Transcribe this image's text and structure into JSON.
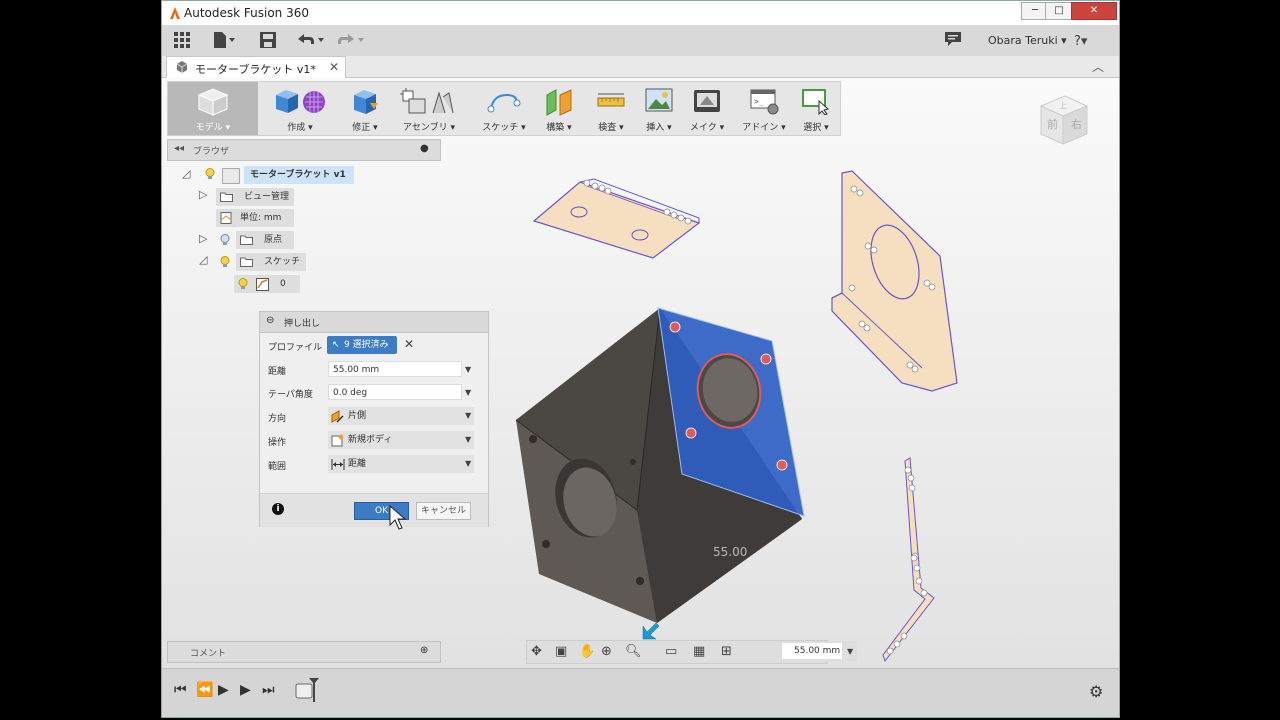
{
  "window": {
    "title": "Autodesk Fusion 360",
    "minimize": "─",
    "maximize": "□",
    "close": "✕"
  },
  "quickbar": {
    "user": "Obara Teruki ▾",
    "help": "?▾"
  },
  "tab": {
    "label": "モーターブラケット v1*",
    "close": "✕"
  },
  "toolbar": [
    {
      "label": "モデル ▾"
    },
    {
      "label": "作成 ▾"
    },
    {
      "label": "修正 ▾"
    },
    {
      "label": "アセンブリ ▾"
    },
    {
      "label": "スケッチ ▾"
    },
    {
      "label": "構築 ▾"
    },
    {
      "label": "検査 ▾"
    },
    {
      "label": "挿入 ▾"
    },
    {
      "label": "メイク ▾"
    },
    {
      "label": "アドイン ▾"
    },
    {
      "label": "選択 ▾"
    }
  ],
  "browser": {
    "title": "ブラウザ",
    "root": "モーターブラケット v1",
    "items": [
      "ビュー管理",
      "単位: mm",
      "原点",
      "スケッチ",
      "0"
    ]
  },
  "dialog": {
    "title": "押し出し",
    "profile_label": "プロファイル",
    "profile_value": "9 選択済み",
    "distance_label": "距離",
    "distance_value": "55.00 mm",
    "taper_label": "テーパ角度",
    "taper_value": "0.0 deg",
    "direction_label": "方向",
    "direction_value": "片側",
    "operation_label": "操作",
    "operation_value": "新規ボディ",
    "extent_label": "範囲",
    "extent_value": "距離",
    "ok": "OK",
    "cancel": "キャンセル"
  },
  "comment": {
    "title": "コメント"
  },
  "viewport": {
    "dimension_label": "55.00",
    "dimension_input": "55.00 mm"
  },
  "viewcube": {
    "front": "前",
    "right": "右",
    "top": "上"
  },
  "colors": {
    "accent": "#3d7cc4",
    "face": "#2f5fc4",
    "body": "#5b5652",
    "sketch": "#f5dfc0"
  }
}
